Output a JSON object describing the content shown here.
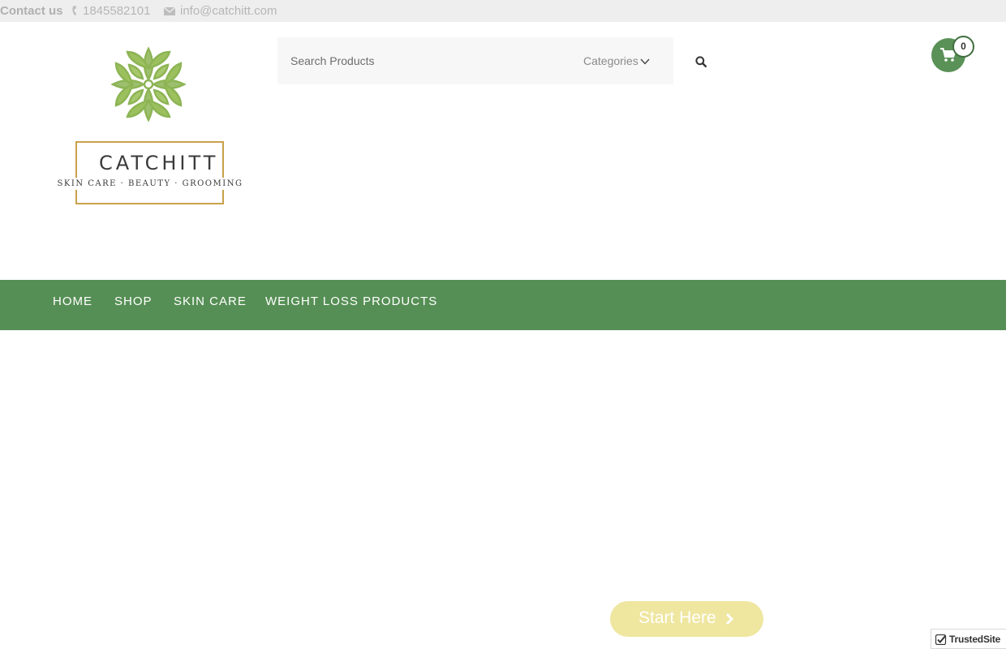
{
  "topbar": {
    "contact_label": "Contact us",
    "phone": "1845582101",
    "email": "info@catchitt.com"
  },
  "logo": {
    "name": "CATCHITT",
    "tagline": "SKIN CARE · BEAUTY · GROOMING"
  },
  "search": {
    "placeholder": "Search Products",
    "categories_label": "Categories"
  },
  "cart": {
    "count": "0"
  },
  "nav": {
    "items": [
      {
        "label": "HOME"
      },
      {
        "label": "SHOP"
      },
      {
        "label": "SKIN CARE"
      },
      {
        "label": "WEIGHT LOSS PRODUCTS"
      }
    ]
  },
  "cta": {
    "start_label": "Start Here"
  },
  "badge": {
    "label": "TrustedSite"
  },
  "colors": {
    "nav_green": "#568f55",
    "cart_green": "#5a9157",
    "logo_leaf": "#8cb454",
    "logo_gold": "#c9a24a",
    "cta_yellow": "#efe6a0"
  }
}
